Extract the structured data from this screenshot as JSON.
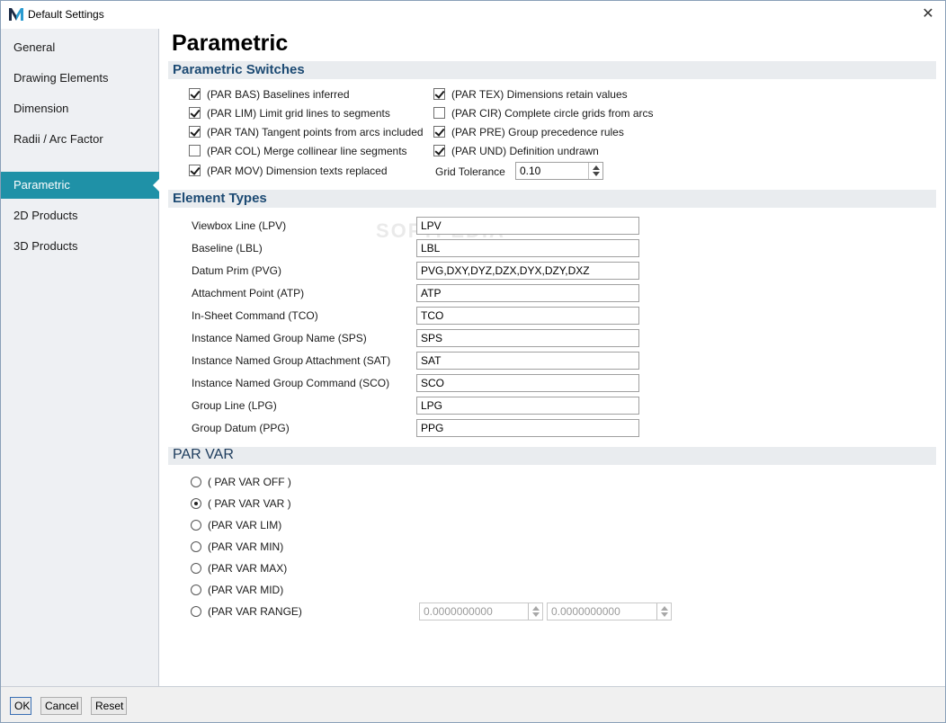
{
  "window": {
    "title": "Default Settings",
    "close_symbol": "✕"
  },
  "sidebar": {
    "items": [
      {
        "label": "General",
        "active": false
      },
      {
        "label": "Drawing Elements",
        "active": false
      },
      {
        "label": "Dimension",
        "active": false
      },
      {
        "label": "Radii / Arc Factor",
        "active": false
      },
      {
        "label": "Parametric",
        "active": true
      },
      {
        "label": "2D Products",
        "active": false
      },
      {
        "label": "3D Products",
        "active": false
      }
    ]
  },
  "page": {
    "title": "Parametric"
  },
  "switches": {
    "header": "Parametric Switches",
    "left": [
      {
        "label": "(PAR BAS) Baselines inferred",
        "checked": true
      },
      {
        "label": "(PAR LIM) Limit grid lines to segments",
        "checked": true
      },
      {
        "label": "(PAR TAN) Tangent points from arcs included",
        "checked": true
      },
      {
        "label": "(PAR COL) Merge collinear line segments",
        "checked": false
      },
      {
        "label": "(PAR MOV) Dimension texts replaced",
        "checked": true
      }
    ],
    "right": [
      {
        "label": "(PAR TEX) Dimensions retain values",
        "checked": true
      },
      {
        "label": "(PAR CIR) Complete circle grids from arcs",
        "checked": false
      },
      {
        "label": "(PAR PRE) Group precedence rules",
        "checked": true
      },
      {
        "label": "(PAR UND) Definition undrawn",
        "checked": true
      }
    ],
    "grid_tolerance": {
      "label": "Grid Tolerance",
      "value": "0.10"
    }
  },
  "element_types": {
    "header": "Element Types",
    "rows": [
      {
        "label": "Viewbox Line (LPV)",
        "value": "LPV"
      },
      {
        "label": "Baseline (LBL)",
        "value": "LBL"
      },
      {
        "label": "Datum Prim (PVG)",
        "value": "PVG,DXY,DYZ,DZX,DYX,DZY,DXZ"
      },
      {
        "label": "Attachment Point (ATP)",
        "value": "ATP"
      },
      {
        "label": "In-Sheet Command (TCO)",
        "value": "TCO"
      },
      {
        "label": "Instance Named Group Name (SPS)",
        "value": "SPS"
      },
      {
        "label": "Instance Named Group Attachment (SAT)",
        "value": "SAT"
      },
      {
        "label": "Instance Named Group Command (SCO)",
        "value": "SCO"
      },
      {
        "label": "Group Line (LPG)",
        "value": "LPG"
      },
      {
        "label": "Group Datum (PPG)",
        "value": "PPG"
      }
    ]
  },
  "par_var": {
    "header": "PAR VAR",
    "options": [
      {
        "label": "( PAR VAR OFF )",
        "selected": false
      },
      {
        "label": "( PAR VAR VAR )",
        "selected": true
      },
      {
        "label": "(PAR VAR LIM)",
        "selected": false
      },
      {
        "label": "(PAR VAR MIN)",
        "selected": false
      },
      {
        "label": "(PAR VAR MAX)",
        "selected": false
      },
      {
        "label": "(PAR VAR MID)",
        "selected": false
      },
      {
        "label": "(PAR VAR RANGE)",
        "selected": false
      }
    ],
    "range_from": "0.0000000000",
    "range_to": "0.0000000000"
  },
  "footer": {
    "ok": "OK",
    "cancel": "Cancel",
    "reset": "Reset"
  },
  "watermark": "SOFTPEDIA",
  "colors": {
    "accent": "#1f91a7",
    "header_text": "#1c4a73",
    "section_bg": "#e9ecef"
  }
}
